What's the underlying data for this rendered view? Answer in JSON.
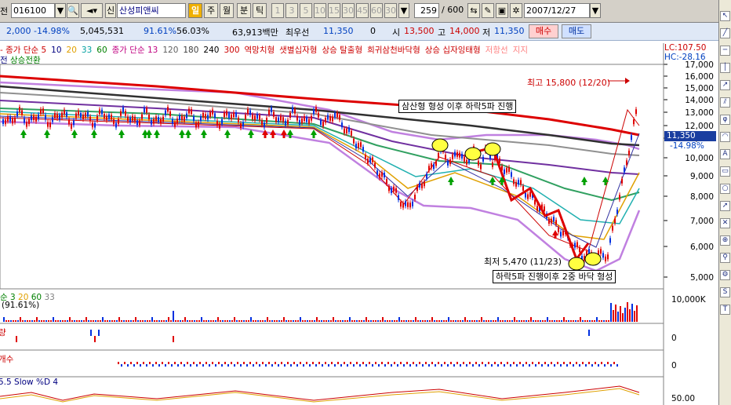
{
  "toolbar": {
    "prefix": "전",
    "code": "016100",
    "type_label": "신",
    "stock_name": "산성피앤씨",
    "periods": [
      "일",
      "주",
      "월",
      "분",
      "틱"
    ],
    "minutes": [
      "1",
      "3",
      "5",
      "10",
      "15",
      "30",
      "45",
      "60",
      "30"
    ],
    "count": "259",
    "max_count": "/ 600",
    "date": "2007/12/27"
  },
  "info": {
    "change": "2,000 -14.98%",
    "volume": "5,045,531",
    "rate1": "91.61%",
    "rate2": "56.03%",
    "amount": "63,913백만",
    "pref_label": "최우선",
    "pref_price": "11,350",
    "pref_zero": "0",
    "open_label": "시",
    "open": "13,500",
    "high_label": "고",
    "high": "14,000",
    "low_label": "저",
    "low": "11,350",
    "buy_label": "매수",
    "sell_label": "매도"
  },
  "legend": {
    "items": [
      {
        "text": "종가 단순 5",
        "color": "#cc0000"
      },
      {
        "text": "10",
        "color": "#000080"
      },
      {
        "text": "20",
        "color": "#e0a000"
      },
      {
        "text": "33",
        "color": "#00a0a0"
      },
      {
        "text": "60",
        "color": "#008000"
      },
      {
        "text": "종가 단순 13",
        "color": "#c00080"
      },
      {
        "text": "120",
        "color": "#606060"
      },
      {
        "text": "180",
        "color": "#404040"
      },
      {
        "text": "240",
        "color": "#000000"
      },
      {
        "text": "300",
        "color": "#cc0000"
      },
      {
        "text": "역망치형",
        "color": "#cc0000"
      },
      {
        "text": "샛별십자형",
        "color": "#cc0000"
      },
      {
        "text": "상승 탈출형",
        "color": "#cc0000"
      },
      {
        "text": "희귀삼천바닥형",
        "color": "#cc0000"
      },
      {
        "text": "상승 십자잉태형",
        "color": "#cc0000"
      },
      {
        "text": "저항선",
        "color": "#ff8080"
      },
      {
        "text": "지지",
        "color": "#ff8080"
      }
    ],
    "row2": "상승전환",
    "row2_prefix": "전"
  },
  "price_scale": [
    "17,000",
    "16,000",
    "15,000",
    "14,000",
    "13,000",
    "12,000",
    "11,000",
    "10,000",
    "9,000",
    "8,000",
    "7,000",
    "6,000",
    "5,000"
  ],
  "lc_label": "LC:107.50",
  "hc_label": "HC:-28.16",
  "current_price": "11,350",
  "current_change": "-14.98%",
  "annotations": {
    "high": "최고 15,800 (12/20)",
    "low": "최저 5,470 (11/23)",
    "note1": "삼산형 형성 이후 하락5파 진행",
    "note2": "하락5파 진행이후 2중 바닥 형성"
  },
  "volume_panel": {
    "label": "순 3 20 60 33",
    "pct": "91.61%)",
    "scale": "10,000K",
    "labels": [
      "순 3",
      "20",
      "60",
      "33"
    ]
  },
  "panel3": {
    "label": "량",
    "scale": "0"
  },
  "panel4": {
    "label": "개수",
    "scale": "0"
  },
  "panel5": {
    "label": "5.5 Slow %D 4",
    "scale": "50.00"
  },
  "colors": {
    "accent": "#cc0000",
    "bb": "#c080e0",
    "up_arrow": "#008000",
    "down_arrow": "#cc0000"
  },
  "right_icons": [
    "cursor-icon",
    "line-icon",
    "hline-icon",
    "vline-icon",
    "trend-icon",
    "channel-icon",
    "fibo-icon",
    "arc-icon",
    "text-icon",
    "rect-icon",
    "circle-icon",
    "arrow-icon",
    "delete-icon",
    "magnet-icon",
    "zoom-icon",
    "settings-icon",
    "S",
    "T"
  ]
}
